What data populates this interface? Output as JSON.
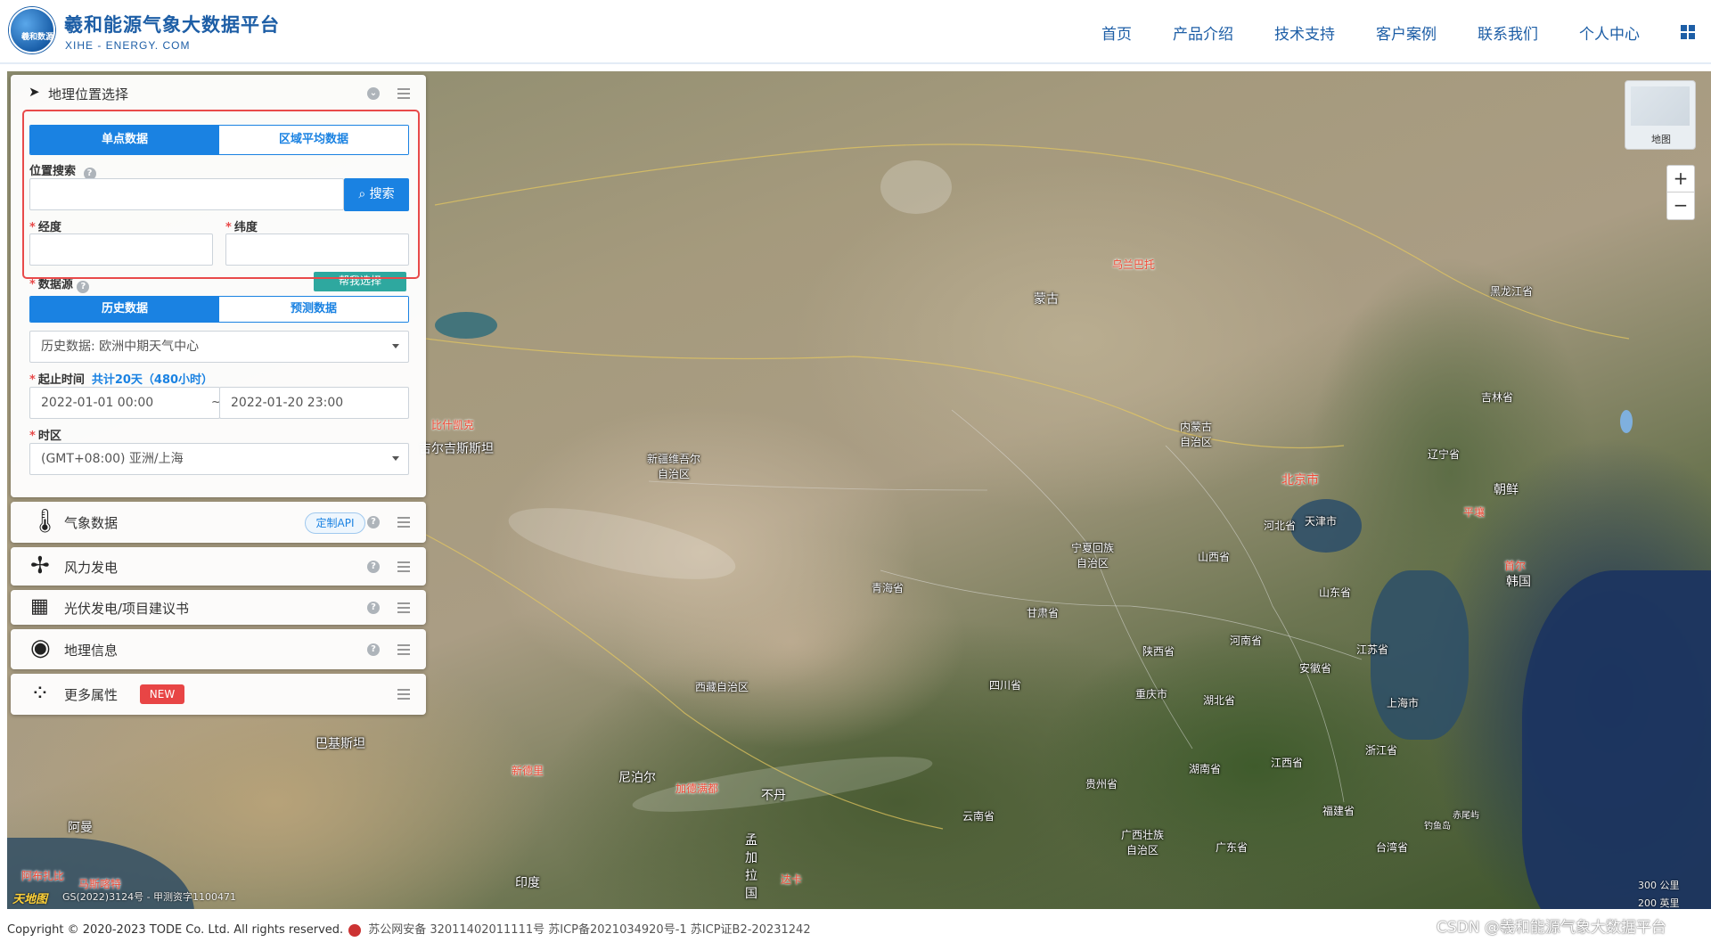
{
  "header": {
    "logo_text": "羲和数源",
    "title": "羲和能源气象大数据平台",
    "subtitle": "XIHE - ENERGY. COM",
    "nav": [
      "首页",
      "产品介绍",
      "技术支持",
      "客户案例",
      "联系我们",
      "个人中心"
    ],
    "nav_color": "#1d5ea6"
  },
  "location_panel": {
    "title": "地理位置选择",
    "tabs": [
      "单点数据",
      "区域平均数据"
    ],
    "active_tab": "单点数据",
    "search_label": "位置搜索",
    "search_value": "",
    "search_button": "搜索",
    "longitude_label": "经度",
    "longitude_value": "",
    "latitude_label": "纬度",
    "latitude_value": "",
    "datasource_label": "数据源",
    "help_button": "帮我选择",
    "data_tabs": [
      "历史数据",
      "预测数据"
    ],
    "active_data_tab": "历史数据",
    "datasource_value": "历史数据: 欧洲中期天气中心",
    "time_label": "起止时间",
    "time_summary": "共计20天（480小时）",
    "start_time": "2022-01-01 00:00",
    "separator": "~",
    "end_time": "2022-01-20 23:00",
    "timezone_label": "时区",
    "timezone_value": "(GMT+08:00) 亚洲/上海",
    "accent_color": "#1a82e2",
    "highlight_color": "#e84a4a"
  },
  "sections": [
    {
      "label": "气象数据",
      "icon": "thermometer-sun-icon",
      "extra": "定制API"
    },
    {
      "label": "风力发电",
      "icon": "wind-turbine-icon"
    },
    {
      "label": "光伏发电/项目建议书",
      "icon": "solar-panel-icon"
    },
    {
      "label": "地理信息",
      "icon": "globe-icon"
    },
    {
      "label": "更多属性",
      "icon": "dots-icon",
      "badge": "NEW"
    }
  ],
  "map": {
    "minimap_label": "地图",
    "zoom_in": "+",
    "zoom_out": "−",
    "labels": {
      "mongolia": "蒙古",
      "ulaanbaatar": "乌兰巴托",
      "heilongjiang": "黑龙江省",
      "jilin": "吉林省",
      "liaoning": "辽宁省",
      "north_korea": "朝鲜",
      "pyongyang": "平壤",
      "seoul": "首尔",
      "south_korea": "韩国",
      "beijing": "北京市",
      "tianjin": "天津市",
      "hebei": "河北省",
      "inner_mongolia": "内蒙古\n自治区",
      "shanxi": "山西省",
      "shandong": "山东省",
      "ningxia": "宁夏回族\n自治区",
      "xinjiang": "新疆维吾尔\n自治区",
      "qinghai": "青海省",
      "gansu": "甘肃省",
      "shaanxi": "陕西省",
      "henan": "河南省",
      "jiangsu": "江苏省",
      "anhui": "安徽省",
      "shanghai": "上海市",
      "hubei": "湖北省",
      "chongqing": "重庆市",
      "sichuan": "四川省",
      "tibet": "西藏自治区",
      "zhejiang": "浙江省",
      "hunan": "湖南省",
      "jiangxi": "江西省",
      "guizhou": "贵州省",
      "fujian": "福建省",
      "yunnan": "云南省",
      "guangxi": "广西壮族\n自治区",
      "guangdong": "广东省",
      "taiwan": "台湾省",
      "kyrgyzstan": "吉尔吉斯斯坦",
      "bishkek": "比什凯克",
      "pakistan": "巴基斯坦",
      "new_delhi": "新德里",
      "nepal": "尼泊尔",
      "kathmandu": "加德满都",
      "bhutan": "不丹",
      "bangladesh": "孟\n加\n拉\n国",
      "dhaka": "达卡",
      "india": "印度",
      "oman": "阿曼",
      "abu_dhabi": "阿布扎比",
      "muscat": "马斯喀特",
      "diaoyu": "钓鱼岛",
      "chiwei": "赤尾屿"
    },
    "logo": "天地图",
    "gs_number": "GS(2022)3124号 - 甲测资字1100471",
    "scale1": "300 公里",
    "scale2": "200 英里"
  },
  "footer": {
    "copyright": "Copyright © 2020-2023 TODE Co. Ltd. All rights reserved.",
    "icp": "苏公网安备 32011402011111号 苏ICP备2021034920号-1 苏ICP证B2-20231242",
    "watermark": "CSDN @羲和能源气象大数据平台"
  }
}
